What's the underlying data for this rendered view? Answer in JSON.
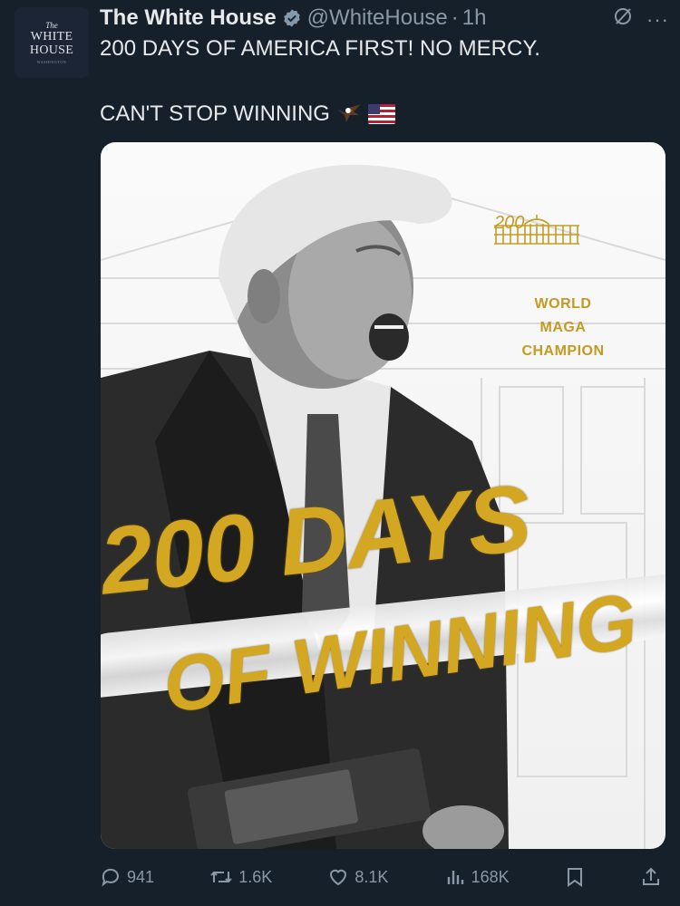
{
  "account": {
    "avatar_lines": [
      "The",
      "WHITE",
      "HOUSE",
      "WASHINGTON"
    ],
    "name": "The White House",
    "handle": "@WhiteHouse",
    "separator": "·",
    "time": "1h",
    "verified_color": "#829aab"
  },
  "tweet": {
    "line1": "200 DAYS OF AMERICA FIRST! NO MERCY.",
    "line2": "CAN'T STOP WINNING",
    "emojis": [
      "eagle-emoji",
      "us-flag-emoji"
    ]
  },
  "media": {
    "logo_number": "200",
    "champion_lines": [
      "WORLD",
      "MAGA",
      "CHAMPION"
    ],
    "headline_top": "200 DAYS",
    "headline_bottom": "OF WINNING",
    "accent_color": "#d3a721"
  },
  "actions": {
    "replies": "941",
    "reposts": "1.6K",
    "likes": "8.1K",
    "views": "168K"
  }
}
